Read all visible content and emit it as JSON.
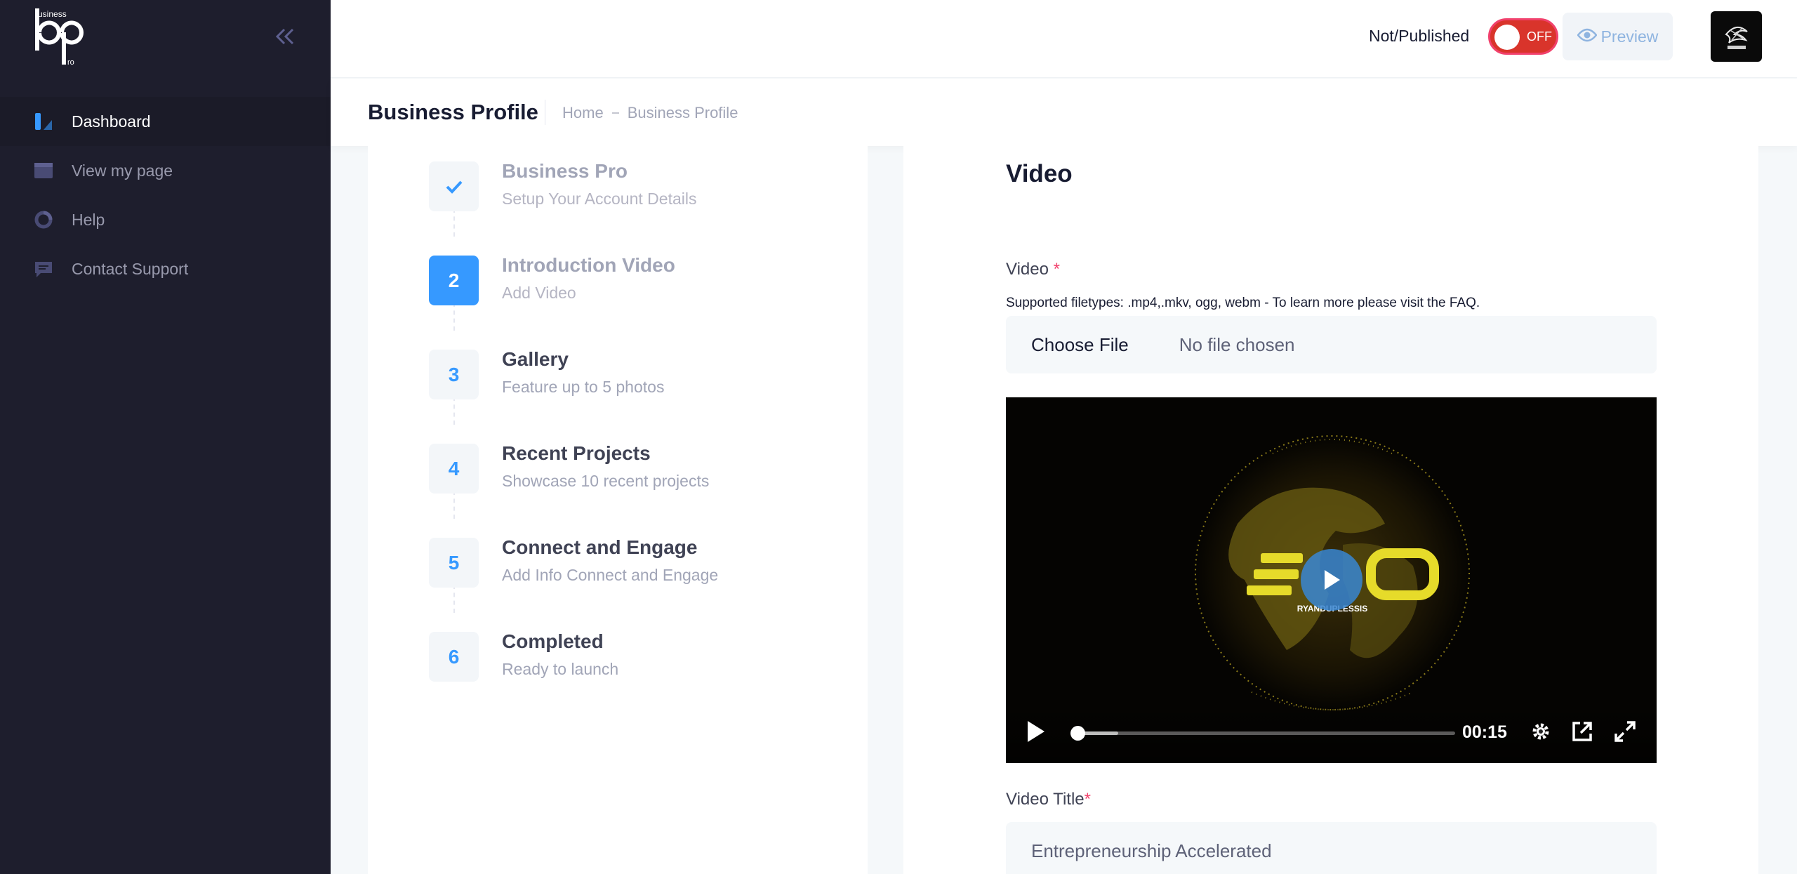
{
  "brand": {
    "logo_text": "business bp pro",
    "collapse_icon": "double-chevron-left-icon"
  },
  "sidebar": {
    "items": [
      {
        "label": "Dashboard",
        "icon": "dashboard-icon",
        "active": true
      },
      {
        "label": "View my page",
        "icon": "window-icon",
        "active": false
      },
      {
        "label": "Help",
        "icon": "help-icon",
        "active": false
      },
      {
        "label": "Contact Support",
        "icon": "message-icon",
        "active": false
      }
    ]
  },
  "header": {
    "publish_status": "Not/Published",
    "toggle_text": "OFF",
    "preview_label": "Preview",
    "avatar_alt": "NO RUSH"
  },
  "toolbar": {
    "title": "Business Profile",
    "breadcrumb": [
      "Home",
      "Business Profile"
    ]
  },
  "steps": [
    {
      "num": "",
      "title": "Business Pro",
      "desc": "Setup Your Account Details",
      "state": "done"
    },
    {
      "num": "2",
      "title": "Introduction Video",
      "desc": "Add Video",
      "state": "active"
    },
    {
      "num": "3",
      "title": "Gallery",
      "desc": "Feature up to 5 photos",
      "state": "pending"
    },
    {
      "num": "4",
      "title": "Recent Projects",
      "desc": "Showcase 10 recent projects",
      "state": "pending"
    },
    {
      "num": "5",
      "title": "Connect and Engage",
      "desc": "Add Info Connect and Engage",
      "state": "pending"
    },
    {
      "num": "6",
      "title": "Completed",
      "desc": "Ready to launch",
      "state": "pending"
    }
  ],
  "form": {
    "title": "Video",
    "video_label": "Video",
    "required_mark": "*",
    "help_text": "Supported filetypes: .mp4,.mkv, ogg, webm - To learn more please visit the FAQ.",
    "file_button": "Choose File",
    "file_status": "No file chosen",
    "video_title_label": "Video Title",
    "video_title_value": "Entrepreneurship Accelerated"
  },
  "player": {
    "time": "00:15",
    "progress": 0.0,
    "buffered": 0.12,
    "overlay_text": "RYANDUPLESSIS"
  },
  "colors": {
    "accent": "#3699ff",
    "sidebar": "#1e1e2d",
    "toggle_off": "#d9342b"
  }
}
